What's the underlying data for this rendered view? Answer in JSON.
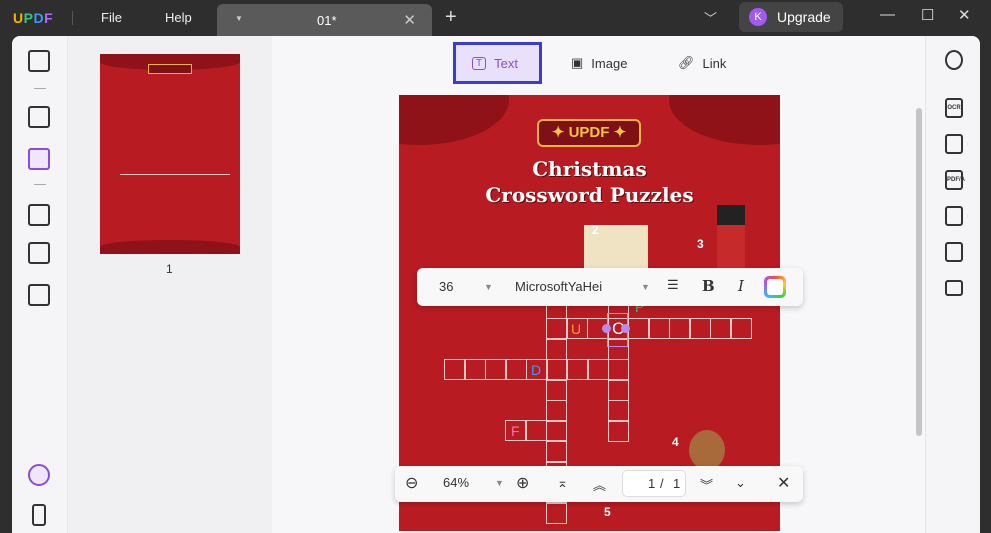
{
  "app": {
    "logo": "UPDF",
    "menu": [
      "File",
      "Help"
    ]
  },
  "tab": {
    "title": "01*"
  },
  "upgrade": {
    "avatar": "K",
    "label": "Upgrade"
  },
  "thumbnail": {
    "page_number": "1"
  },
  "modes": {
    "text": "Text",
    "image": "Image",
    "link": "Link"
  },
  "poster": {
    "badge": "✦ UPDF ✦",
    "title_line1": "Christmas",
    "title_line2": "Crossword Puzzles",
    "letters": [
      "U",
      "C",
      "P",
      "D",
      "F"
    ],
    "numbers": [
      "2",
      "3",
      "4",
      "5"
    ]
  },
  "text_toolbar": {
    "font_size": "36",
    "font_name": "MicrosoftYaHei",
    "bold": "B",
    "italic": "I",
    "color": "#ffffff"
  },
  "zoom_bar": {
    "zoom": "64%",
    "current_page": "1",
    "separator": "/",
    "total_pages": "1"
  }
}
